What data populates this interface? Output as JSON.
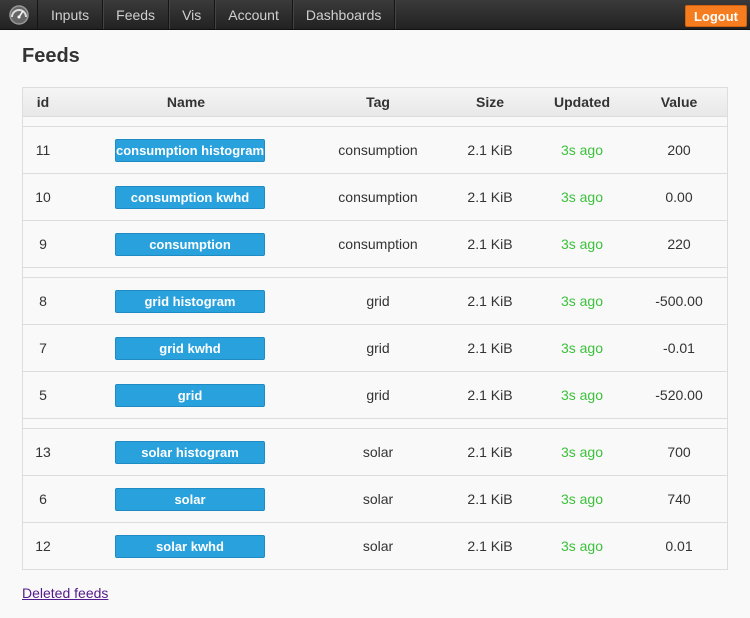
{
  "nav": {
    "items": [
      "Inputs",
      "Feeds",
      "Vis",
      "Account",
      "Dashboards"
    ],
    "logout_label": "Logout"
  },
  "page_title": "Feeds",
  "table": {
    "headers": {
      "id": "id",
      "name": "Name",
      "tag": "Tag",
      "size": "Size",
      "updated": "Updated",
      "value": "Value"
    },
    "groups": [
      [
        {
          "id": "11",
          "name": "consumption histogram",
          "tag": "consumption",
          "size": "2.1 KiB",
          "updated": "3s ago",
          "value": "200"
        },
        {
          "id": "10",
          "name": "consumption kwhd",
          "tag": "consumption",
          "size": "2.1 KiB",
          "updated": "3s ago",
          "value": "0.00"
        },
        {
          "id": "9",
          "name": "consumption",
          "tag": "consumption",
          "size": "2.1 KiB",
          "updated": "3s ago",
          "value": "220"
        }
      ],
      [
        {
          "id": "8",
          "name": "grid histogram",
          "tag": "grid",
          "size": "2.1 KiB",
          "updated": "3s ago",
          "value": "-500.00"
        },
        {
          "id": "7",
          "name": "grid kwhd",
          "tag": "grid",
          "size": "2.1 KiB",
          "updated": "3s ago",
          "value": "-0.01"
        },
        {
          "id": "5",
          "name": "grid",
          "tag": "grid",
          "size": "2.1 KiB",
          "updated": "3s ago",
          "value": "-520.00"
        }
      ],
      [
        {
          "id": "13",
          "name": "solar histogram",
          "tag": "solar",
          "size": "2.1 KiB",
          "updated": "3s ago",
          "value": "700"
        },
        {
          "id": "6",
          "name": "solar",
          "tag": "solar",
          "size": "2.1 KiB",
          "updated": "3s ago",
          "value": "740"
        },
        {
          "id": "12",
          "name": "solar kwhd",
          "tag": "solar",
          "size": "2.1 KiB",
          "updated": "3s ago",
          "value": "0.01"
        }
      ]
    ]
  },
  "deleted_feeds_label": "Deleted feeds",
  "colors": {
    "accent": "#29a1dd",
    "logout": "#f57c1f",
    "updated": "#3cc13c"
  },
  "icons": {
    "brand": "gauge-logo-icon"
  }
}
